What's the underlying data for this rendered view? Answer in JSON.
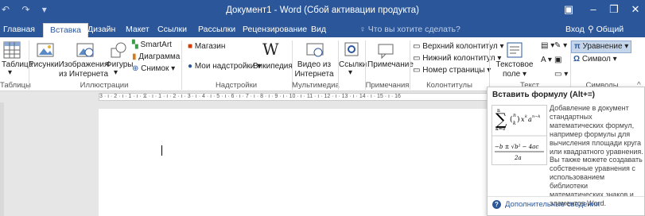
{
  "window": {
    "title": "Документ1 - Word (Сбой активации продукта)",
    "qat_icons": [
      "undo-icon",
      "redo-icon",
      "customize-icon"
    ],
    "controls": [
      "ribbon-display-icon",
      "minimize-icon",
      "maximize-icon",
      "close-icon"
    ]
  },
  "tabs": [
    {
      "label": "Главная"
    },
    {
      "label": "Вставка",
      "active": true
    },
    {
      "label": "Дизайн"
    },
    {
      "label": "Макет"
    },
    {
      "label": "Ссылки"
    },
    {
      "label": "Рассылки"
    },
    {
      "label": "Рецензирование"
    },
    {
      "label": "Вид"
    }
  ],
  "tellme": "Что вы хотите сделать?",
  "signin": "Вход",
  "share": "Общий доступ",
  "ribbon": {
    "tables": {
      "item": "Таблица",
      "group": "Таблицы"
    },
    "illustrations": {
      "pictures": "Рисунки",
      "online_pictures": "Изображения из Интернета",
      "online_line1": "Изображения",
      "online_line2": "из Интернета",
      "shapes": "Фигуры",
      "smartart": "SmartArt",
      "chart": "Диаграмма",
      "screenshot": "Снимок",
      "group": "Иллюстрации"
    },
    "addins": {
      "store": "Магазин",
      "my_addins": "Мои надстройки",
      "wikipedia": "Википедия",
      "group": "Надстройки"
    },
    "media": {
      "online_video_line1": "Видео из",
      "online_video_line2": "Интернета",
      "group": "Мультимедиа"
    },
    "links": {
      "links": "Ссылки"
    },
    "comments": {
      "comment": "Примечание",
      "group": "Примечания"
    },
    "header_footer": {
      "header": "Верхний колонтитул",
      "footer": "Нижний колонтитул",
      "page_number": "Номер страницы",
      "group": "Колонтитулы"
    },
    "text": {
      "textbox_line1": "Текстовое",
      "textbox_line2": "поле",
      "group": "Текст"
    },
    "symbols": {
      "equation": "Уравнение",
      "symbol": "Символ",
      "group": "Символы"
    }
  },
  "ruler": {
    "text": "3 · ı · 2 · ı · 1 · ı · ⧖ · ı · 1 · ı · 2 · ı · 3 · ı · 4 · ı · 5 · ı · 6 · ı · 7 · ı · 8 · ı · 9 · ı · 10 · ı · 11 · ı · 12 · ı · 13 · ı · 14 · ı · 15 · ı · 16"
  },
  "tooltip": {
    "title": "Вставить формулу (Alt+=)",
    "description": "Добавление в документ стандартных математических формул, например формулы для вычисления площади круга или квадратного уравнения.",
    "description2": "Вы также можете создавать собственные уравнения с использованием библиотеки математических знаков и элементов Word.",
    "more": "Дополнительные сведения"
  },
  "colors": {
    "accent": "#2b579a",
    "ribbon_bg": "#ffffff",
    "canvas_bg": "#e6e6e6"
  }
}
